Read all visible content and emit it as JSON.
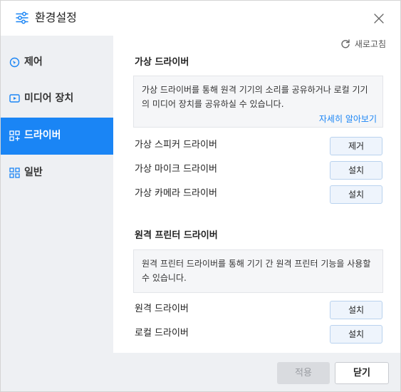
{
  "window": {
    "title": "환경설정",
    "title_icon": "settings-sliders-icon",
    "close_icon": "close-icon"
  },
  "sidebar": {
    "items": [
      {
        "label": "제어",
        "icon": "control-icon",
        "active": false
      },
      {
        "label": "미디어 장치",
        "icon": "media-device-icon",
        "active": false
      },
      {
        "label": "드라이버",
        "icon": "driver-icon",
        "active": true
      },
      {
        "label": "일반",
        "icon": "general-icon",
        "active": false
      }
    ]
  },
  "main": {
    "refresh_label": "새로고침",
    "virtual_section": {
      "title": "가상 드라이버",
      "info_text": "가상 드라이버를 통해 원격 기기의 소리를 공유하거나 로컬 기기의 미디어 장치를 공유하실 수 있습니다.",
      "learn_more": "자세히 알아보기",
      "rows": [
        {
          "label": "가상 스피커 드라이버",
          "button": "제거"
        },
        {
          "label": "가상 마이크 드라이버",
          "button": "설치"
        },
        {
          "label": "가상 카메라 드라이버",
          "button": "설치"
        }
      ]
    },
    "printer_section": {
      "title": "원격 프린터 드라이버",
      "info_text": "원격 프린터 드라이버를 통해 기기 간 원격 프린터 기능을 사용할 수 있습니다.",
      "rows": [
        {
          "label": "원격 드라이버",
          "button": "설치"
        },
        {
          "label": "로컬 드라이버",
          "button": "설치"
        }
      ]
    }
  },
  "footer": {
    "apply_label": "적용",
    "close_label": "닫기"
  },
  "colors": {
    "accent": "#1a85f5",
    "sidebar_bg": "#eef0f3",
    "info_bg": "#f5f6f8"
  }
}
